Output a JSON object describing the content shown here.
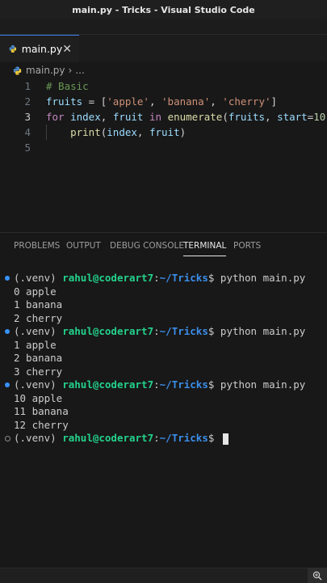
{
  "window": {
    "title": "main.py - Tricks - Visual Studio Code"
  },
  "tabs": [
    {
      "label": "main.py",
      "close": "✕",
      "icon": "python-icon"
    }
  ],
  "breadcrumb": {
    "file": "main.py",
    "separator": "›",
    "more": "..."
  },
  "editor": {
    "line_numbers": [
      "1",
      "2",
      "3",
      "4",
      "5"
    ],
    "lines": [
      [
        {
          "t": "# Basic",
          "c": "cm"
        }
      ],
      [
        {
          "t": "fruits",
          "c": "var"
        },
        {
          "t": " = [",
          "c": "pl"
        },
        {
          "t": "'apple'",
          "c": "str"
        },
        {
          "t": ", ",
          "c": "pl"
        },
        {
          "t": "'banana'",
          "c": "str"
        },
        {
          "t": ", ",
          "c": "pl"
        },
        {
          "t": "'cherry'",
          "c": "str"
        },
        {
          "t": "]",
          "c": "pl"
        }
      ],
      [
        {
          "t": "for",
          "c": "kw"
        },
        {
          "t": " ",
          "c": "pl"
        },
        {
          "t": "index",
          "c": "var"
        },
        {
          "t": ", ",
          "c": "pl"
        },
        {
          "t": "fruit",
          "c": "var"
        },
        {
          "t": " ",
          "c": "pl"
        },
        {
          "t": "in",
          "c": "kw"
        },
        {
          "t": " ",
          "c": "pl"
        },
        {
          "t": "enumerate",
          "c": "fn"
        },
        {
          "t": "(",
          "c": "pl"
        },
        {
          "t": "fruits",
          "c": "var"
        },
        {
          "t": ", ",
          "c": "pl"
        },
        {
          "t": "start",
          "c": "var"
        },
        {
          "t": "=",
          "c": "pl"
        },
        {
          "t": "10",
          "c": "num"
        },
        {
          "t": "):",
          "c": "pl"
        }
      ],
      [
        {
          "t": "    ",
          "c": "pl"
        },
        {
          "t": "print",
          "c": "fn"
        },
        {
          "t": "(",
          "c": "pl"
        },
        {
          "t": "index",
          "c": "var"
        },
        {
          "t": ", ",
          "c": "pl"
        },
        {
          "t": "fruit",
          "c": "var"
        },
        {
          "t": ")",
          "c": "pl"
        }
      ],
      []
    ],
    "active_line": 3
  },
  "panel": {
    "tabs": [
      "PROBLEMS",
      "OUTPUT",
      "DEBUG CONSOLE",
      "TERMINAL",
      "PORTS"
    ],
    "active_tab": "TERMINAL"
  },
  "terminal": {
    "prompt": {
      "venv": "(.venv) ",
      "user": "rahul@coderart7",
      "sep": ":",
      "path": "~/Tricks",
      "dollar": "$ "
    },
    "lines": [
      {
        "type": "prompt",
        "dot": "blue",
        "cmd": "python main.py"
      },
      {
        "type": "out",
        "text": "0 apple"
      },
      {
        "type": "out",
        "text": "1 banana"
      },
      {
        "type": "out",
        "text": "2 cherry"
      },
      {
        "type": "prompt",
        "dot": "blue",
        "cmd": "python main.py"
      },
      {
        "type": "out",
        "text": "1 apple"
      },
      {
        "type": "out",
        "text": "2 banana"
      },
      {
        "type": "out",
        "text": "3 cherry"
      },
      {
        "type": "prompt",
        "dot": "blue",
        "cmd": "python main.py"
      },
      {
        "type": "out",
        "text": "10 apple"
      },
      {
        "type": "out",
        "text": "11 banana"
      },
      {
        "type": "out",
        "text": "12 cherry"
      },
      {
        "type": "prompt",
        "dot": "grey",
        "cmd": "",
        "cursor": true
      }
    ]
  },
  "statusbar": {
    "zoom_icon": "zoom-in-icon"
  }
}
